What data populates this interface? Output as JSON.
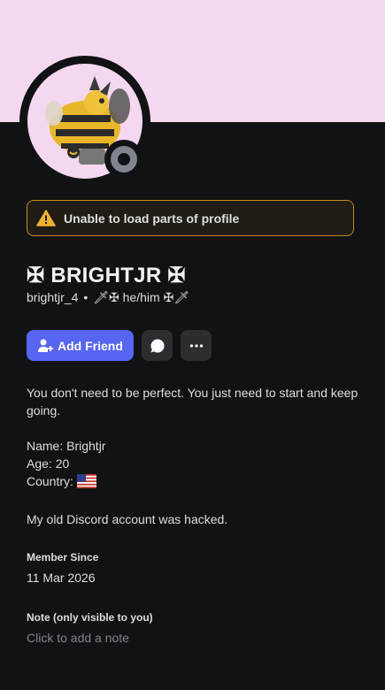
{
  "colors": {
    "banner": "#f5d8ef",
    "background": "#111214",
    "accent": "#5865f2",
    "warning_border": "#c58a18",
    "warning_icon": "#f0b232",
    "status_offline": "#80848e"
  },
  "banner": {
    "icon": "profile-banner"
  },
  "avatar": {
    "icon": "bee-creature-avatar",
    "status": "offline"
  },
  "warning": {
    "icon": "warning-triangle-icon",
    "text": "Unable to load parts of profile"
  },
  "profile": {
    "display_name": "✠ BRIGHTJR ✠",
    "username": "brightjr_4",
    "separator": "•",
    "pronouns": "🗡✠ he/him ✠🗡"
  },
  "actions": {
    "add_friend_label": "Add Friend",
    "add_friend_icon": "person-add-icon",
    "message_icon": "chat-bubble-icon",
    "more_icon": "more-dots-icon"
  },
  "bio": {
    "line1": "You don't need to be perfect. You just need to start and keep going.",
    "name": "Name: Brightjr",
    "age": "Age: 20",
    "country": "Country:",
    "country_flag_icon": "us-flag-icon",
    "line2": "My old Discord account was hacked."
  },
  "member_since": {
    "label": "Member Since",
    "value": "11 Mar 2026"
  },
  "note": {
    "label": "Note (only visible to you)",
    "placeholder": "Click to add a note"
  }
}
